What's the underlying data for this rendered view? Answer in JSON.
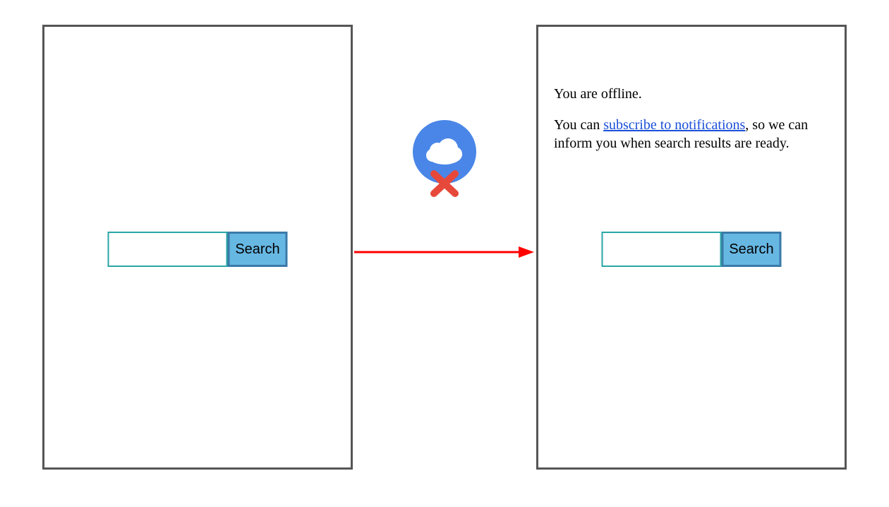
{
  "left": {
    "search": {
      "button_label": "Search",
      "input_value": ""
    }
  },
  "right": {
    "offline_line": "You are offline.",
    "prefix": "You can ",
    "link_text": "subscribe to notifications",
    "suffix": ", so we can inform you when search results are ready.",
    "search": {
      "button_label": "Search",
      "input_value": ""
    }
  },
  "icons": {
    "cloud_offline": "cloud-offline-icon",
    "arrow": "arrow-right-icon"
  },
  "colors": {
    "panel_border": "#555555",
    "button_fill": "#67b7e3",
    "button_border": "#3a7aa8",
    "input_border": "#2aa6a6",
    "arrow": "#ff0000",
    "cloud_circle": "#4a86e8",
    "cloud_x": "#e6483a",
    "link": "#1a4fd8"
  }
}
